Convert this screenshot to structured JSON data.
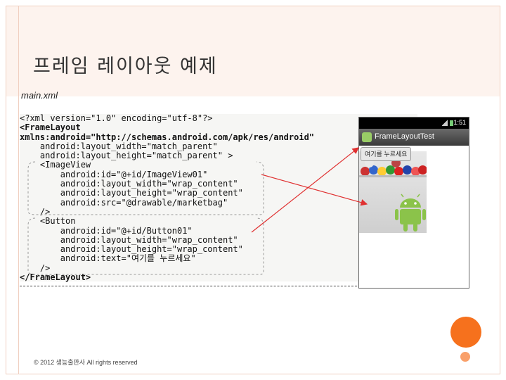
{
  "slide": {
    "title": "프레임 레이아웃 예제",
    "subtitle": "main.xml",
    "footer": "© 2012 생능출판사 All rights reserved"
  },
  "code_lines": [
    {
      "text": "<?xml version=\"1.0\" encoding=\"utf-8\"?>",
      "bold": false
    },
    {
      "text": "<FrameLayout",
      "bold": true
    },
    {
      "text": "xmlns:android=\"http://schemas.android.com/apk/res/android\"",
      "bold": true
    },
    {
      "text": "    android:layout_width=\"match_parent\"",
      "bold": false
    },
    {
      "text": "    android:layout_height=\"match_parent\" >",
      "bold": false
    },
    {
      "text": "    <ImageView",
      "bold": false
    },
    {
      "text": "        android:id=\"@+id/ImageView01\"",
      "bold": false
    },
    {
      "text": "        android:layout_width=\"wrap_content\"",
      "bold": false
    },
    {
      "text": "        android:layout_height=\"wrap_content\"",
      "bold": false
    },
    {
      "text": "        android:src=\"@drawable/marketbag\"",
      "bold": false
    },
    {
      "text": "    />",
      "bold": false
    },
    {
      "text": "    <Button",
      "bold": false
    },
    {
      "text": "        android:id=\"@+id/Button01\"",
      "bold": false
    },
    {
      "text": "        android:layout_width=\"wrap_content\"",
      "bold": false
    },
    {
      "text": "        android:layout_height=\"wrap_content\"",
      "bold": false
    },
    {
      "text": "        android:text=\"여기를 누르세요\"",
      "bold": false
    },
    {
      "text": "    />",
      "bold": false
    },
    {
      "text": "</FrameLayout>",
      "bold": true
    }
  ],
  "phone": {
    "status_time": "1:51",
    "app_title": "FrameLayoutTest",
    "button_label": "여기를 누르세요"
  },
  "colors": {
    "accent_orange": "#f6711d",
    "arrow_red": "#e03030",
    "frame_border": "#f0cfc0"
  }
}
